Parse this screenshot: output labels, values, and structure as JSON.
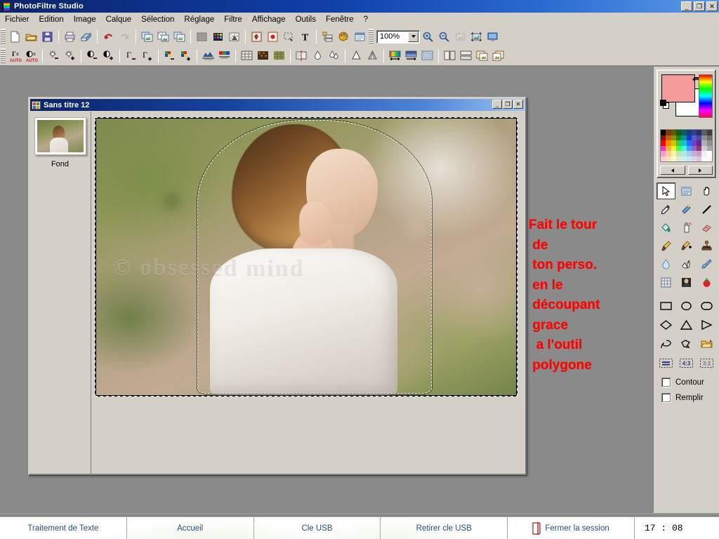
{
  "window": {
    "title": "PhotoFiltre Studio",
    "app_icon": "filmstrip-icon",
    "min_label": "_",
    "restore_label": "❐",
    "close_label": "✕"
  },
  "menu": {
    "items": [
      {
        "label": "Fichier"
      },
      {
        "label": "Edition"
      },
      {
        "label": "Image"
      },
      {
        "label": "Calque"
      },
      {
        "label": "Sélection"
      },
      {
        "label": "Réglage"
      },
      {
        "label": "Filtre"
      },
      {
        "label": "Affichage"
      },
      {
        "label": "Outils"
      },
      {
        "label": "Fenêtre"
      },
      {
        "label": "?"
      }
    ]
  },
  "toolbar1": {
    "zoom_value": "100%",
    "buttons": [
      {
        "name": "new-icon",
        "title": "Nouveau"
      },
      {
        "name": "open-icon",
        "title": "Ouvrir"
      },
      {
        "name": "save-icon",
        "title": "Enregistrer"
      },
      {
        "name": "print-icon",
        "title": "Imprimer"
      },
      {
        "name": "print-preview-icon",
        "title": "Aperçu avant impression"
      },
      {
        "name": "undo-icon",
        "title": "Annuler"
      },
      {
        "name": "redo-icon",
        "title": "Rétablir"
      },
      {
        "name": "copy-image-icon",
        "title": "Copier"
      },
      {
        "name": "paste-image-icon",
        "title": "Coller"
      },
      {
        "name": "duplicate-image-icon",
        "title": "Dupliquer"
      },
      {
        "name": "grayscale-icon",
        "title": "Niveaux de gris"
      },
      {
        "name": "color-mode-icon",
        "title": "Mode couleur"
      },
      {
        "name": "transparency-icon",
        "title": "Transparence"
      },
      {
        "name": "mask-icon",
        "title": "Masque"
      },
      {
        "name": "red-eye-icon",
        "title": "Yeux rouges"
      },
      {
        "name": "selection-icon",
        "title": "Sélection"
      },
      {
        "name": "text-icon",
        "title": "Texte"
      },
      {
        "name": "layers-icon",
        "title": "Calques"
      },
      {
        "name": "palette-icon",
        "title": "Palette"
      },
      {
        "name": "dialog-icon",
        "title": "Explorateur"
      },
      {
        "name": "zoom-in-icon",
        "title": "Zoom avant"
      },
      {
        "name": "zoom-out-icon",
        "title": "Zoom arrière"
      },
      {
        "name": "fit-icon",
        "title": "Ajuster"
      },
      {
        "name": "actual-size-icon",
        "title": "Taille réelle"
      },
      {
        "name": "fullscreen-icon",
        "title": "Plein écran"
      }
    ]
  },
  "toolbar2": {
    "buttons": [
      {
        "name": "auto-gamma-icon",
        "title": "Gamma auto"
      },
      {
        "name": "auto-contrast-icon",
        "title": "Contraste auto"
      },
      {
        "name": "brightness-down-icon",
        "title": "Luminosité -"
      },
      {
        "name": "brightness-up-icon",
        "title": "Luminosité +"
      },
      {
        "name": "contrast-down-icon",
        "title": "Contraste -"
      },
      {
        "name": "contrast-up-icon",
        "title": "Contraste +"
      },
      {
        "name": "gamma-down-icon",
        "title": "Gamma -"
      },
      {
        "name": "gamma-up-icon",
        "title": "Gamma +"
      },
      {
        "name": "saturation-down-icon",
        "title": "Saturation -"
      },
      {
        "name": "saturation-up-icon",
        "title": "Saturation +"
      },
      {
        "name": "histogram-icon",
        "title": "Histogramme"
      },
      {
        "name": "levels-icon",
        "title": "Niveaux"
      },
      {
        "name": "grid-icon",
        "title": "Grille"
      },
      {
        "name": "mosaic-icon",
        "title": "Mosaïque"
      },
      {
        "name": "texture-icon",
        "title": "Texture"
      },
      {
        "name": "gradient-mask-icon",
        "title": "Dégradé masque"
      },
      {
        "name": "blur-icon",
        "title": "Flou"
      },
      {
        "name": "blur-more-icon",
        "title": "Flou +"
      },
      {
        "name": "sharpen-icon",
        "title": "Netteté"
      },
      {
        "name": "sharpen-more-icon",
        "title": "Netteté +"
      },
      {
        "name": "color-gradient-icon",
        "title": "Dégradé couleur"
      },
      {
        "name": "blue-gradient-icon",
        "title": "Dégradé bleu"
      },
      {
        "name": "frame-icon",
        "title": "Encadrement"
      },
      {
        "name": "book-icon",
        "title": "Module"
      },
      {
        "name": "split-icon",
        "title": "Séparer"
      },
      {
        "name": "export-icon",
        "title": "Exporter"
      },
      {
        "name": "import-icon",
        "title": "Importer"
      }
    ]
  },
  "document": {
    "title": "Sans titre 12",
    "min_label": "_",
    "restore_label": "❐",
    "close_label": "✕",
    "layer_label": "Fond",
    "watermark_text": "©  obsessed mind"
  },
  "annotation": {
    "text": "Fait le tour\n de\n ton perso.\n en le\n découpant\n grace\n  a l'outil\n polygone",
    "color": "#ff0000"
  },
  "palette": {
    "foreground_color": "#f59a9a",
    "background_color": "#ffffff",
    "swatches": [
      "#000000",
      "#7a3b10",
      "#5c5c10",
      "#0d5c10",
      "#0d5c5c",
      "#10407a",
      "#3b3b8f",
      "#2a2a6e",
      "#5c5c5c",
      "#3d3d3d",
      "#8f0d0d",
      "#c85a0d",
      "#8f8f0d",
      "#0d8f0d",
      "#0d8f8f",
      "#0d3dc8",
      "#5a5ac8",
      "#4a4a9f",
      "#8f8f8f",
      "#6e6e6e",
      "#ff0000",
      "#ff8a00",
      "#c8c800",
      "#3dc83d",
      "#0dc8c8",
      "#2a6aff",
      "#7a3dc8",
      "#5c2a8f",
      "#b0b0b0",
      "#8f8f8f",
      "#ff2ad4",
      "#ffb03d",
      "#f0f03d",
      "#3dff3d",
      "#3dffd4",
      "#3da0ff",
      "#a05ad4",
      "#8a3d6e",
      "#cfcfcf",
      "#a8a8a8",
      "#ff9ad4",
      "#ffcf9a",
      "#f5f5a8",
      "#b8e8b0",
      "#b0e8e0",
      "#a8cdf0",
      "#c0b0e0",
      "#c8a0c0",
      "#f0f0f0",
      "#ffffff",
      "#ffc8dc",
      "#ffe0c0",
      "#fafac8",
      "#d8f0d0",
      "#d0f0ea",
      "#cde2f7",
      "#ddd4ef",
      "#e0c8da",
      "#fafafa",
      "#ffffff"
    ],
    "arrow_left": "◄",
    "arrow_right": "►",
    "tools": [
      {
        "name": "arrow-select-tool",
        "label": "Flèche",
        "active": true
      },
      {
        "name": "clipboard-tool",
        "label": "Presse-papiers",
        "active": false
      },
      {
        "name": "hand-tool",
        "label": "Main",
        "active": false
      },
      {
        "name": "eyedropper-tool",
        "label": "Pipette",
        "active": false
      },
      {
        "name": "magic-wand-tool",
        "label": "Baguette magique",
        "active": false
      },
      {
        "name": "line-tool",
        "label": "Ligne",
        "active": false
      },
      {
        "name": "paint-bucket-tool",
        "label": "Pot de peinture",
        "active": false
      },
      {
        "name": "spray-tool",
        "label": "Aérographe",
        "active": false
      },
      {
        "name": "eraser-tool",
        "label": "Gomme",
        "active": false
      },
      {
        "name": "brush-tool",
        "label": "Pinceau",
        "active": false
      },
      {
        "name": "brush-plus-tool",
        "label": "Pinceau avancé",
        "active": false
      },
      {
        "name": "stamp-tool",
        "label": "Tampon",
        "active": false
      },
      {
        "name": "water-drop-tool",
        "label": "Goutte d'eau",
        "active": false
      },
      {
        "name": "smudge-tool",
        "label": "Doigt",
        "active": false
      },
      {
        "name": "broom-tool",
        "label": "Balai",
        "active": false
      },
      {
        "name": "grid-deform-tool",
        "label": "Grille déformation",
        "active": false
      },
      {
        "name": "portrait-tool",
        "label": "Portrait",
        "active": false
      },
      {
        "name": "strawberry-tool",
        "label": "Fraise",
        "active": false
      }
    ],
    "shapes": [
      {
        "name": "rectangle-shape",
        "label": "Rectangle"
      },
      {
        "name": "ellipse-shape",
        "label": "Ellipse"
      },
      {
        "name": "rounded-rect-shape",
        "label": "Rectangle arrondi"
      },
      {
        "name": "diamond-shape",
        "label": "Losange"
      },
      {
        "name": "triangle-shape",
        "label": "Triangle"
      },
      {
        "name": "right-triangle-shape",
        "label": "Triangle rectangle"
      },
      {
        "name": "lasso-shape",
        "label": "Lasso"
      },
      {
        "name": "polygon-shape",
        "label": "Polygone"
      },
      {
        "name": "open-shape-folder",
        "label": "Ouvrir forme"
      }
    ],
    "ratios": [
      {
        "name": "ratio-free",
        "label": ""
      },
      {
        "name": "ratio-4-3",
        "label": "4:3"
      },
      {
        "name": "ratio-3-2",
        "label": "3:2"
      }
    ],
    "checkboxes": [
      {
        "name": "contour-checkbox",
        "label": "Contour",
        "checked": false
      },
      {
        "name": "remplir-checkbox",
        "label": "Remplir",
        "checked": false
      }
    ]
  },
  "taskbar": {
    "items": [
      {
        "name": "taskbar-traitement-de-texte",
        "label": "Traitement de Texte"
      },
      {
        "name": "taskbar-accueil",
        "label": "Accueil"
      },
      {
        "name": "taskbar-cle-usb",
        "label": "Cle USB"
      },
      {
        "name": "taskbar-retirer-cle-usb",
        "label": "Retirer cle USB"
      },
      {
        "name": "taskbar-fermer-la-session",
        "label": "Fermer la session",
        "icon": "door-icon"
      }
    ],
    "clock": "17 : 08"
  }
}
